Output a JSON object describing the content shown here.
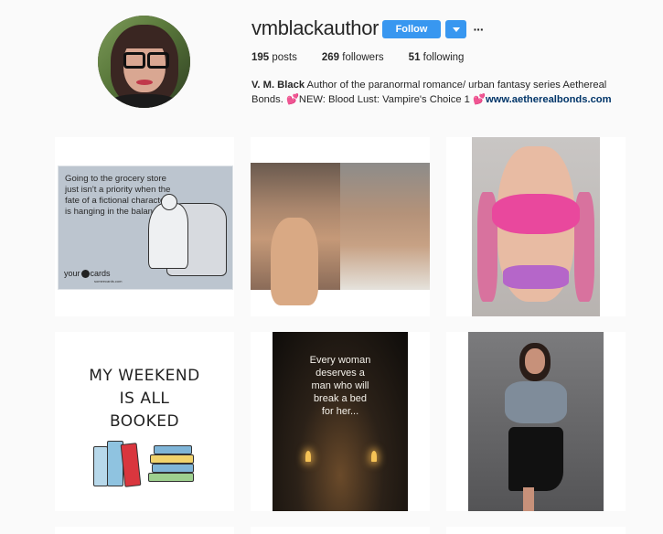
{
  "profile": {
    "username": "vmblackauthor",
    "follow_label": "Follow",
    "more_label": "···",
    "stats": {
      "posts_count": "195",
      "posts_label": "posts",
      "followers_count": "269",
      "followers_label": "followers",
      "following_count": "51",
      "following_label": "following"
    },
    "bio": {
      "name": "V. M. Black",
      "text": "Author of the paranormal romance/ urban fantasy series Aethereal Bonds.",
      "heart1": "💕",
      "new_text": "NEW: Blood Lust: Vampire's Choice 1",
      "heart2": "💕",
      "link": "www.aetherealbonds.com"
    }
  },
  "posts": {
    "p1": {
      "text": "Going to the grocery store just isn't a priority when the fate of a fictional character is hanging in the balance.",
      "brand_a": "your",
      "brand_b": "cards",
      "brand_sub": "someecards.com"
    },
    "p4": {
      "line1": "MY WEEKEND",
      "line2": "IS ALL",
      "line3": "BOOKED"
    },
    "p5": {
      "line1": "Every woman",
      "line2": "deserves a",
      "line3": "man who will",
      "line4": "break a bed",
      "line5": "for her..."
    }
  },
  "colors": {
    "follow_blue": "#3897f0",
    "link_navy": "#003569",
    "background": "#fafafa"
  },
  "icons": {
    "dropdown": "chevron-down-icon",
    "more": "more-options-icon"
  }
}
